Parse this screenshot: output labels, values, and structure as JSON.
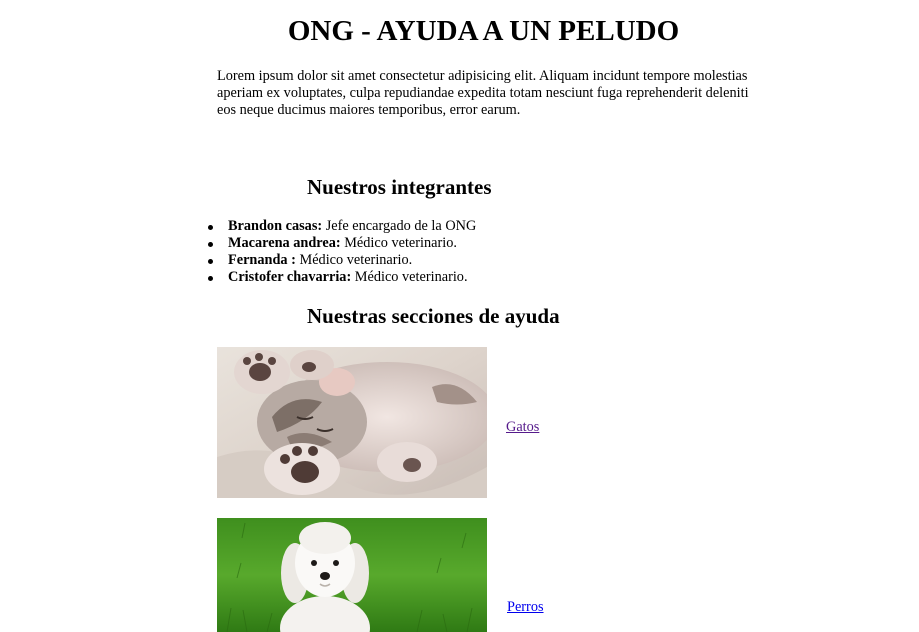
{
  "header": {
    "title": "ONG - AYUDA A UN PELUDO",
    "intro": "Lorem ipsum dolor sit amet consectetur adipisicing elit. Aliquam incidunt tempore molestias aperiam ex voluptates, culpa repudiandae expedita totam nesciunt fuga reprehenderit deleniti eos neque ducimus maiores temporibus, error earum."
  },
  "members": {
    "heading": "Nuestros integrantes",
    "items": [
      {
        "name": "Brandon casas:",
        "role": " Jefe encargado de la ONG"
      },
      {
        "name": "Macarena andrea:",
        "role": " Médico veterinario."
      },
      {
        "name": "Fernanda :",
        "role": " Médico veterinario."
      },
      {
        "name": "Cristofer chavarria:",
        "role": " Médico veterinario."
      }
    ]
  },
  "sections": {
    "heading": "Nuestras secciones de ayuda",
    "items": [
      {
        "link": "Gatos",
        "image": "sleeping-kitten-photo",
        "visited": true
      },
      {
        "link": "Perros",
        "image": "white-puppy-on-grass-photo",
        "visited": false
      }
    ]
  },
  "colors": {
    "link": "#0000ee",
    "visited_link": "#551a8b"
  }
}
